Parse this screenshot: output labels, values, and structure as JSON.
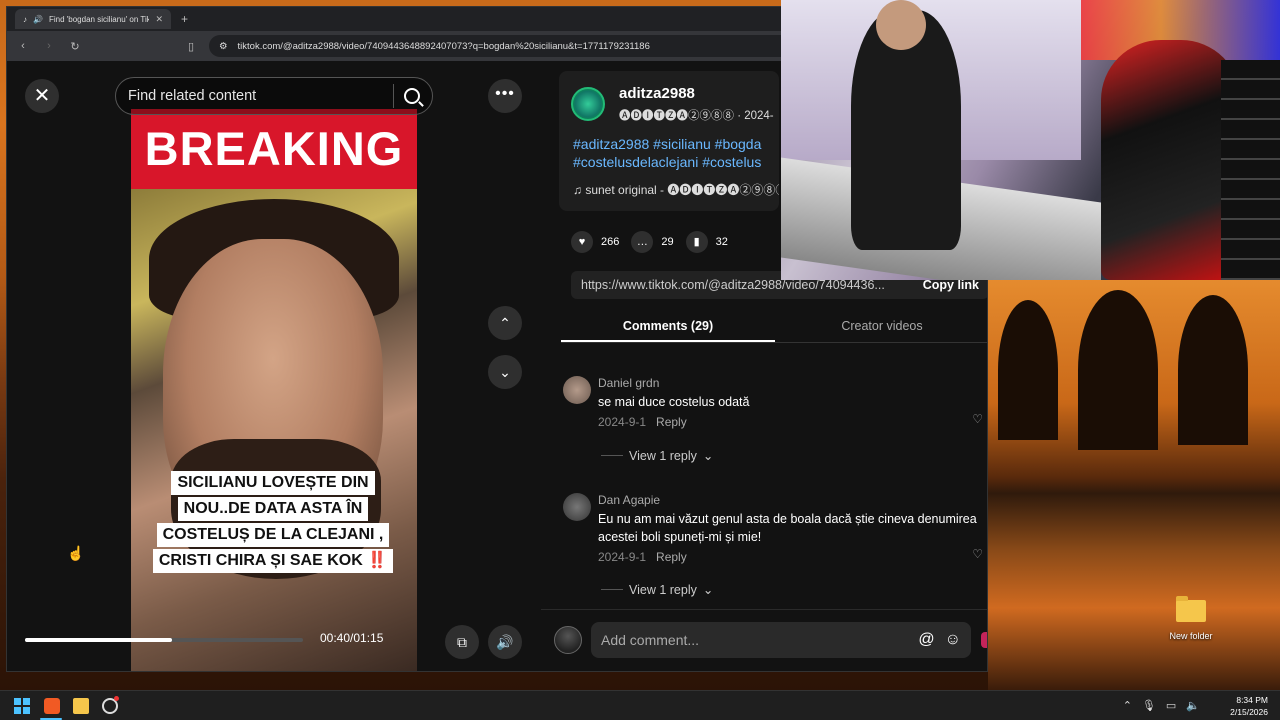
{
  "browser": {
    "tab_title": "Find 'bogdan sicilianu' on Tik",
    "tab_close": "✕",
    "new_tab": "+",
    "url": "tiktok.com/@aditza2988/video/7409443648892407073?q=bogdan%20sicilianu&t=1771179231186"
  },
  "page": {
    "close_glyph": "✕",
    "search_placeholder": "Find related content",
    "more_glyph": "•••",
    "video": {
      "banner_text": "BREAKING",
      "caption_lines": [
        "SICILIANU LOVEȘTE DIN",
        "NOU..DE DATA ASTA ÎN",
        "COSTELUȘ DE LA CLEJANI ,",
        "CRISTI CHIRA ȘI SAE KOK"
      ],
      "caption_bang": "‼️",
      "progress": 0.53,
      "time": "00:40/01:15"
    },
    "arrow_up": "⌃",
    "arrow_down": "⌄",
    "volume_glyph": "🔊",
    "pip_glyph": "⧉"
  },
  "panel": {
    "author_name": "aditza2988",
    "author_meta": "🅐🅓🅘🅣🅩🅐②⑨⑧⑧ · 2024-",
    "hashtags": "#aditza2988 #sicilianu #bogda #costelusdelaclejani #costelus",
    "sound": "♫  sunet original - 🅐🅓🅘🅣🅩🅐②⑨⑧⑧",
    "stats": {
      "likes": "266",
      "comments": "29",
      "saves": "32"
    },
    "link": "https://www.tiktok.com/@aditza2988/video/74094436...",
    "copy_link": "Copy link",
    "tabs": [
      "Comments (29)",
      "Creator videos"
    ],
    "comments": [
      {
        "user": "Daniel grdn",
        "text": "se mai duce costelus odată",
        "date": "2024-9-1",
        "reply": "Reply",
        "view_replies": "View 1 reply"
      },
      {
        "user": "Dan Agapie",
        "text": "Eu nu am mai văzut genul asta de boala dacă știe cineva denumirea acestei boli spuneți-mi și mie!",
        "date": "2024-9-1",
        "reply": "Reply",
        "view_replies": "View 1 reply"
      }
    ],
    "comment_placeholder": "Add comment...",
    "mention_glyph": "@",
    "emoji_glyph": "☺"
  },
  "desktop": {
    "folder_label": "New folder"
  },
  "taskbar": {
    "time": "8:34 PM",
    "date": "2/15/2026"
  },
  "colors": {
    "accent_pink": "#c4245a",
    "breaking_red": "#d8162a",
    "hashtag_blue": "#6ab8ff"
  }
}
